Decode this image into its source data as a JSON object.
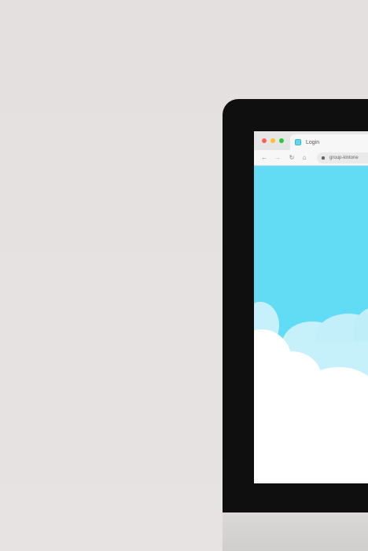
{
  "browser": {
    "tab_title": "Login",
    "url_text": "group-kintone"
  },
  "page": {
    "background_color": "#62dcf4",
    "scene": "sky-with-clouds"
  }
}
